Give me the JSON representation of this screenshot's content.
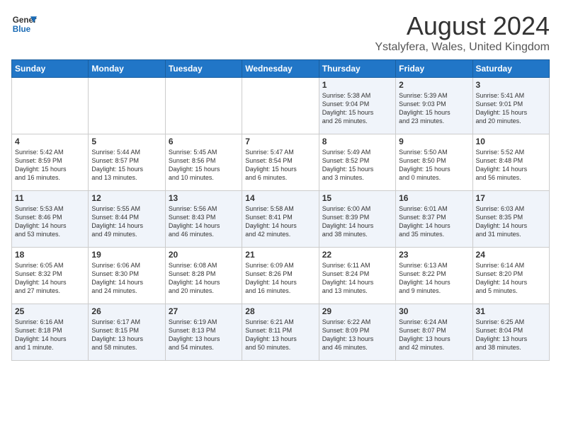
{
  "header": {
    "logo_line1": "General",
    "logo_line2": "Blue",
    "month_year": "August 2024",
    "location": "Ystalyfera, Wales, United Kingdom"
  },
  "calendar": {
    "days_of_week": [
      "Sunday",
      "Monday",
      "Tuesday",
      "Wednesday",
      "Thursday",
      "Friday",
      "Saturday"
    ],
    "weeks": [
      [
        {
          "day": "",
          "content": ""
        },
        {
          "day": "",
          "content": ""
        },
        {
          "day": "",
          "content": ""
        },
        {
          "day": "",
          "content": ""
        },
        {
          "day": "1",
          "content": "Sunrise: 5:38 AM\nSunset: 9:04 PM\nDaylight: 15 hours\nand 26 minutes."
        },
        {
          "day": "2",
          "content": "Sunrise: 5:39 AM\nSunset: 9:03 PM\nDaylight: 15 hours\nand 23 minutes."
        },
        {
          "day": "3",
          "content": "Sunrise: 5:41 AM\nSunset: 9:01 PM\nDaylight: 15 hours\nand 20 minutes."
        }
      ],
      [
        {
          "day": "4",
          "content": "Sunrise: 5:42 AM\nSunset: 8:59 PM\nDaylight: 15 hours\nand 16 minutes."
        },
        {
          "day": "5",
          "content": "Sunrise: 5:44 AM\nSunset: 8:57 PM\nDaylight: 15 hours\nand 13 minutes."
        },
        {
          "day": "6",
          "content": "Sunrise: 5:45 AM\nSunset: 8:56 PM\nDaylight: 15 hours\nand 10 minutes."
        },
        {
          "day": "7",
          "content": "Sunrise: 5:47 AM\nSunset: 8:54 PM\nDaylight: 15 hours\nand 6 minutes."
        },
        {
          "day": "8",
          "content": "Sunrise: 5:49 AM\nSunset: 8:52 PM\nDaylight: 15 hours\nand 3 minutes."
        },
        {
          "day": "9",
          "content": "Sunrise: 5:50 AM\nSunset: 8:50 PM\nDaylight: 15 hours\nand 0 minutes."
        },
        {
          "day": "10",
          "content": "Sunrise: 5:52 AM\nSunset: 8:48 PM\nDaylight: 14 hours\nand 56 minutes."
        }
      ],
      [
        {
          "day": "11",
          "content": "Sunrise: 5:53 AM\nSunset: 8:46 PM\nDaylight: 14 hours\nand 53 minutes."
        },
        {
          "day": "12",
          "content": "Sunrise: 5:55 AM\nSunset: 8:44 PM\nDaylight: 14 hours\nand 49 minutes."
        },
        {
          "day": "13",
          "content": "Sunrise: 5:56 AM\nSunset: 8:43 PM\nDaylight: 14 hours\nand 46 minutes."
        },
        {
          "day": "14",
          "content": "Sunrise: 5:58 AM\nSunset: 8:41 PM\nDaylight: 14 hours\nand 42 minutes."
        },
        {
          "day": "15",
          "content": "Sunrise: 6:00 AM\nSunset: 8:39 PM\nDaylight: 14 hours\nand 38 minutes."
        },
        {
          "day": "16",
          "content": "Sunrise: 6:01 AM\nSunset: 8:37 PM\nDaylight: 14 hours\nand 35 minutes."
        },
        {
          "day": "17",
          "content": "Sunrise: 6:03 AM\nSunset: 8:35 PM\nDaylight: 14 hours\nand 31 minutes."
        }
      ],
      [
        {
          "day": "18",
          "content": "Sunrise: 6:05 AM\nSunset: 8:32 PM\nDaylight: 14 hours\nand 27 minutes."
        },
        {
          "day": "19",
          "content": "Sunrise: 6:06 AM\nSunset: 8:30 PM\nDaylight: 14 hours\nand 24 minutes."
        },
        {
          "day": "20",
          "content": "Sunrise: 6:08 AM\nSunset: 8:28 PM\nDaylight: 14 hours\nand 20 minutes."
        },
        {
          "day": "21",
          "content": "Sunrise: 6:09 AM\nSunset: 8:26 PM\nDaylight: 14 hours\nand 16 minutes."
        },
        {
          "day": "22",
          "content": "Sunrise: 6:11 AM\nSunset: 8:24 PM\nDaylight: 14 hours\nand 13 minutes."
        },
        {
          "day": "23",
          "content": "Sunrise: 6:13 AM\nSunset: 8:22 PM\nDaylight: 14 hours\nand 9 minutes."
        },
        {
          "day": "24",
          "content": "Sunrise: 6:14 AM\nSunset: 8:20 PM\nDaylight: 14 hours\nand 5 minutes."
        }
      ],
      [
        {
          "day": "25",
          "content": "Sunrise: 6:16 AM\nSunset: 8:18 PM\nDaylight: 14 hours\nand 1 minute."
        },
        {
          "day": "26",
          "content": "Sunrise: 6:17 AM\nSunset: 8:15 PM\nDaylight: 13 hours\nand 58 minutes."
        },
        {
          "day": "27",
          "content": "Sunrise: 6:19 AM\nSunset: 8:13 PM\nDaylight: 13 hours\nand 54 minutes."
        },
        {
          "day": "28",
          "content": "Sunrise: 6:21 AM\nSunset: 8:11 PM\nDaylight: 13 hours\nand 50 minutes."
        },
        {
          "day": "29",
          "content": "Sunrise: 6:22 AM\nSunset: 8:09 PM\nDaylight: 13 hours\nand 46 minutes."
        },
        {
          "day": "30",
          "content": "Sunrise: 6:24 AM\nSunset: 8:07 PM\nDaylight: 13 hours\nand 42 minutes."
        },
        {
          "day": "31",
          "content": "Sunrise: 6:25 AM\nSunset: 8:04 PM\nDaylight: 13 hours\nand 38 minutes."
        }
      ]
    ]
  }
}
